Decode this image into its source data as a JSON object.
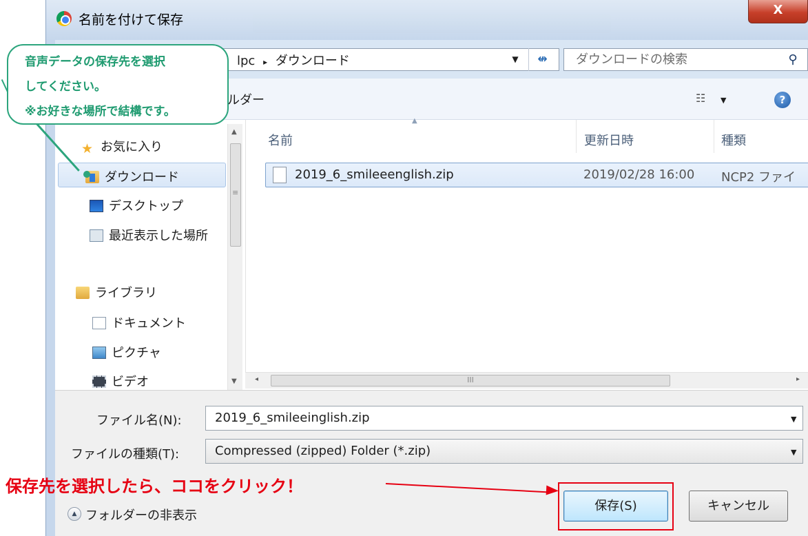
{
  "window": {
    "title": "名前を付けて保存",
    "close_label": "X"
  },
  "address": {
    "path_fragment": "lpc",
    "separator": "▸",
    "current": "ダウンロード",
    "dropdown": "▼",
    "refresh": "↮"
  },
  "search": {
    "placeholder": "ダウンロードの検索",
    "icon": "⚲"
  },
  "toolbar": {
    "folder_label": "ルダー",
    "view_icon": "☷",
    "view_arrow": "▼",
    "help": "?"
  },
  "nav": {
    "items": [
      {
        "label": "お気に入り",
        "icon": "star-icon"
      },
      {
        "label": "ダウンロード",
        "icon": "downloads-folder-icon"
      },
      {
        "label": "デスクトップ",
        "icon": "desktop-icon"
      },
      {
        "label": "最近表示した場所",
        "icon": "recent-places-icon"
      },
      {
        "label": "ライブラリ",
        "icon": "library-icon"
      },
      {
        "label": "ドキュメント",
        "icon": "documents-icon"
      },
      {
        "label": "ピクチャ",
        "icon": "pictures-icon"
      },
      {
        "label": "ビデオ",
        "icon": "videos-icon"
      }
    ],
    "scroll_up": "▲",
    "scroll_down": "▼",
    "scroll_grip": "≡"
  },
  "files": {
    "columns": [
      "名前",
      "更新日時",
      "種類"
    ],
    "sort_arrow": "▲",
    "rows": [
      {
        "name": "2019_6_smileeenglish.zip",
        "modified": "2019/02/28 16:00",
        "type": "NCP2 ファイ"
      }
    ],
    "hscroll_left": "◂",
    "hscroll_right": "▸",
    "hscroll_grip": "III"
  },
  "form": {
    "filename_label": "ファイル名(N):",
    "filename_value": "2019_6_smileeinglish.zip",
    "filetype_label": "ファイルの種類(T):",
    "filetype_value": "Compressed (zipped) Folder (*.zip)",
    "drop": "▼"
  },
  "footer": {
    "collapse_icon": "▲",
    "collapse_label": "フォルダーの非表示",
    "save_button": "保存(S)",
    "cancel_button": "キャンセル"
  },
  "annotations": {
    "callout_lines": [
      "音声データの保存先を選択",
      "してください。",
      "※お好きな場所で結構です。"
    ],
    "red_instruction": "保存先を選択したら、ココをクリック！",
    "callout_color": "#2ca57d",
    "highlight_color": "#e60012"
  }
}
